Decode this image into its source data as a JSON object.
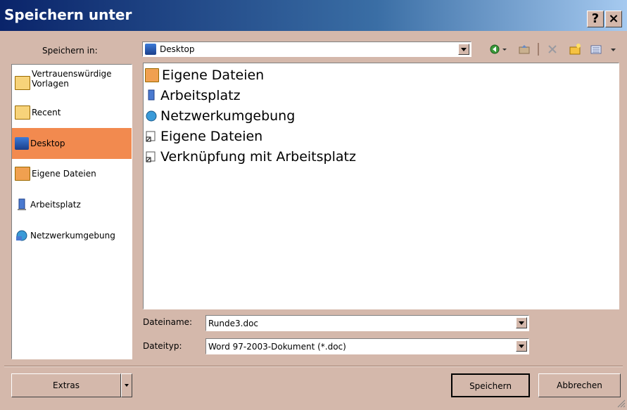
{
  "window": {
    "title": "Speichern unter",
    "help_btn": "?",
    "close_btn": "×"
  },
  "save_in": {
    "label": "Speichern in:",
    "value": "Desktop"
  },
  "places": [
    {
      "label": "Vertrauenswürdige Vorlagen",
      "icon": "folder-icon"
    },
    {
      "label": "Recent",
      "icon": "folder-icon"
    },
    {
      "label": "Desktop",
      "icon": "desktop-icon",
      "selected": true
    },
    {
      "label": "Eigene Dateien",
      "icon": "documents-icon"
    },
    {
      "label": "Arbeitsplatz",
      "icon": "computer-icon"
    },
    {
      "label": "Netzwerkumgebung",
      "icon": "network-icon"
    }
  ],
  "files": [
    {
      "label": "Eigene Dateien",
      "icon": "documents-icon"
    },
    {
      "label": "Arbeitsplatz",
      "icon": "computer-icon"
    },
    {
      "label": "Netzwerkumgebung",
      "icon": "network-icon"
    },
    {
      "label": "Eigene Dateien",
      "icon": "shortcut-icon"
    },
    {
      "label": "Verknüpfung mit Arbeitsplatz",
      "icon": "shortcut-icon"
    }
  ],
  "filename": {
    "label": "Dateiname:",
    "value": "Runde3.doc"
  },
  "filetype": {
    "label": "Dateityp:",
    "value": "Word 97-2003-Dokument (*.doc)"
  },
  "buttons": {
    "extras": "Extras",
    "save": "Speichern",
    "cancel": "Abbrechen"
  },
  "colors": {
    "selection": "#f28a4f",
    "dialog_bg": "#d4b8ab",
    "title_start": "#0a246a",
    "title_end": "#a6caf0"
  }
}
